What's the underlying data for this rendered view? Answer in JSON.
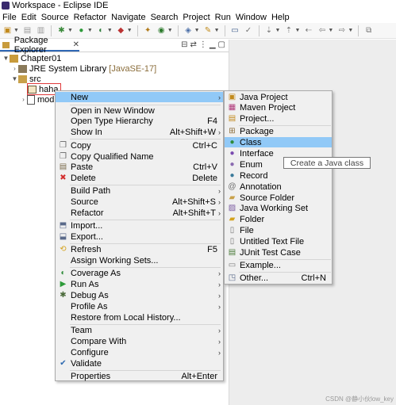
{
  "window": {
    "title": "Workspace - Eclipse IDE"
  },
  "menubar": [
    "File",
    "Edit",
    "Source",
    "Refactor",
    "Navigate",
    "Search",
    "Project",
    "Run",
    "Window",
    "Help"
  ],
  "explorer": {
    "tab_label": "Package Explorer",
    "tree": {
      "project": "Chapter01",
      "jre": "JRE System Library",
      "jre_version": "[JavaSE-17]",
      "src": "src",
      "package": "haha",
      "module_file": "modu"
    }
  },
  "context_menu": {
    "items": [
      {
        "label": "New",
        "shortcut": "",
        "submenu": true
      },
      {
        "label": "Open in New Window",
        "shortcut": ""
      },
      {
        "label": "Open Type Hierarchy",
        "shortcut": "F4"
      },
      {
        "label": "Show In",
        "shortcut": "Alt+Shift+W",
        "submenu": true
      },
      {
        "label": "Copy",
        "shortcut": "Ctrl+C"
      },
      {
        "label": "Copy Qualified Name",
        "shortcut": ""
      },
      {
        "label": "Paste",
        "shortcut": "Ctrl+V"
      },
      {
        "label": "Delete",
        "shortcut": "Delete"
      },
      {
        "label": "Build Path",
        "shortcut": "",
        "submenu": true
      },
      {
        "label": "Source",
        "shortcut": "Alt+Shift+S",
        "submenu": true
      },
      {
        "label": "Refactor",
        "shortcut": "Alt+Shift+T",
        "submenu": true
      },
      {
        "label": "Import...",
        "shortcut": ""
      },
      {
        "label": "Export...",
        "shortcut": ""
      },
      {
        "label": "Refresh",
        "shortcut": "F5"
      },
      {
        "label": "Assign Working Sets...",
        "shortcut": ""
      },
      {
        "label": "Coverage As",
        "shortcut": "",
        "submenu": true
      },
      {
        "label": "Run As",
        "shortcut": "",
        "submenu": true
      },
      {
        "label": "Debug As",
        "shortcut": "",
        "submenu": true
      },
      {
        "label": "Profile As",
        "shortcut": "",
        "submenu": true
      },
      {
        "label": "Restore from Local History...",
        "shortcut": ""
      },
      {
        "label": "Team",
        "shortcut": "",
        "submenu": true
      },
      {
        "label": "Compare With",
        "shortcut": "",
        "submenu": true
      },
      {
        "label": "Configure",
        "shortcut": "",
        "submenu": true
      },
      {
        "label": "Validate",
        "shortcut": ""
      },
      {
        "label": "Properties",
        "shortcut": "Alt+Enter"
      }
    ]
  },
  "submenu": {
    "items": [
      {
        "label": "Java Project"
      },
      {
        "label": "Maven Project"
      },
      {
        "label": "Project..."
      },
      {
        "label": "Package"
      },
      {
        "label": "Class"
      },
      {
        "label": "Interface"
      },
      {
        "label": "Enum"
      },
      {
        "label": "Record"
      },
      {
        "label": "Annotation"
      },
      {
        "label": "Source Folder"
      },
      {
        "label": "Java Working Set"
      },
      {
        "label": "Folder"
      },
      {
        "label": "File"
      },
      {
        "label": "Untitled Text File"
      },
      {
        "label": "JUnit Test Case"
      },
      {
        "label": "Example..."
      },
      {
        "label": "Other...",
        "shortcut": "Ctrl+N"
      }
    ]
  },
  "tooltip": "Create a Java class",
  "watermark": "CSDN @静小伙low_key",
  "colors": {
    "highlight": "#91c9f7",
    "selection_border": "#e0393a",
    "tab_accent": "#2f67b4"
  }
}
